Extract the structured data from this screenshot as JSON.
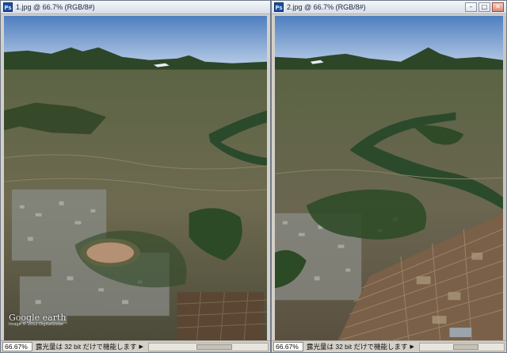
{
  "windows": [
    {
      "title": "1.jpg @ 66.7% (RGB/8#)",
      "icon": "ps-icon",
      "zoom": "66.67%",
      "status": "露光量は 32 bit だけで機能します",
      "watermark": "Google earth",
      "watermark_sub": "Image © 2012 DigitalGlobe",
      "buttons": []
    },
    {
      "title": "2.jpg @ 66.7% (RGB/8#)",
      "icon": "ps-icon",
      "zoom": "66.67%",
      "status": "露光量は 32 bit だけで機能します",
      "buttons": [
        "minimize",
        "maximize",
        "close"
      ]
    }
  ],
  "colors": {
    "sky_top": "#5a87c4",
    "sky_bottom": "#b8cce4",
    "mountain": "#2f4a2a",
    "terrain": "#6b6a4a",
    "river": "#2e4d2e"
  }
}
